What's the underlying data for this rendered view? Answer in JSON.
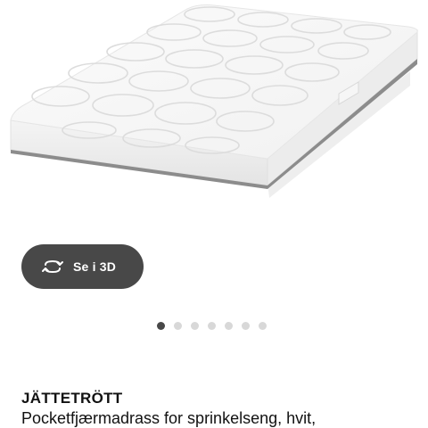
{
  "product_image": {
    "alt": "mattress-product-image"
  },
  "view_3d_button": {
    "label": "Se i 3D",
    "icon": "rotate-3d-icon"
  },
  "carousel": {
    "total": 7,
    "active_index": 0
  },
  "product": {
    "name": "JÄTTETRÖTT",
    "description": "Pocketfjærmadrass for sprinkelseng, hvit,"
  },
  "colors": {
    "button_bg": "#484848",
    "dot_active": "#484848",
    "dot_inactive": "#d8d8d8"
  }
}
